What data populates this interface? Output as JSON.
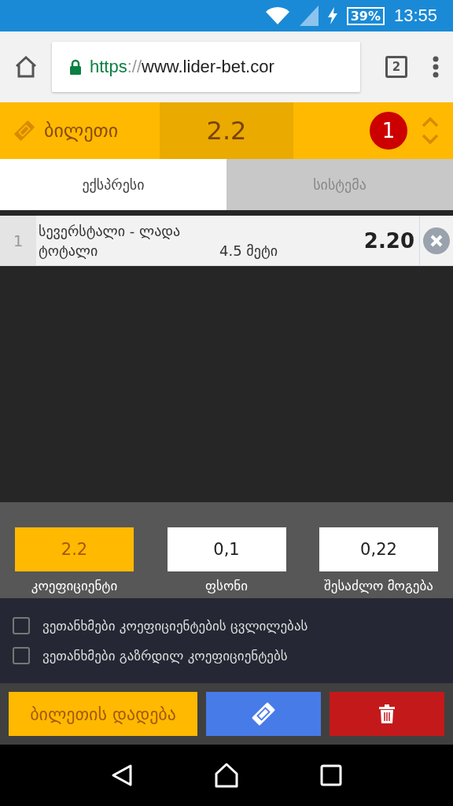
{
  "status_bar": {
    "battery": "39%",
    "time": "13:55"
  },
  "browser": {
    "url_scheme": "https",
    "url_sep": "://",
    "url_rest": "www.lider-bet.cor",
    "tab_count": "2"
  },
  "ticket_header": {
    "title": "ბილეთი",
    "odds": "2.2",
    "count": "1"
  },
  "tabs": [
    {
      "label": "ექსპრესი",
      "selected": true
    },
    {
      "label": "სისტემა",
      "selected": false
    }
  ],
  "bets": [
    {
      "index": "1",
      "match": "სევერსტალი - ლადა",
      "market": "ტოტალი",
      "pick": "4.5 მეტი",
      "odds": "2.20"
    }
  ],
  "summary": [
    {
      "value": "2.2",
      "label": "კოეფიციენტი",
      "highlighted": true
    },
    {
      "value": "0,1",
      "label": "ფსონი",
      "highlighted": false
    },
    {
      "value": "0,22",
      "label": "შესაძლო მოგება",
      "highlighted": false
    }
  ],
  "options": [
    {
      "label": "ვეთანხმები კოეფიციენტების ცვლილებას",
      "checked": false
    },
    {
      "label": "ვეთანხმები გაზრდილ კოეფიციენტებს",
      "checked": false
    }
  ],
  "actions": {
    "place_label": "ბილეთის დადება"
  }
}
